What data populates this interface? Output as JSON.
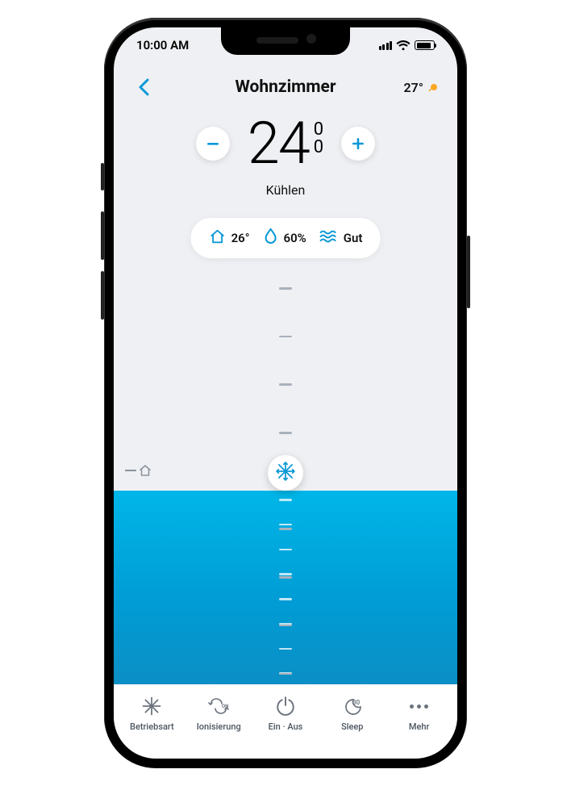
{
  "statusbar": {
    "time": "10:00 AM"
  },
  "header": {
    "room": "Wohnzimmer",
    "outside_temp": "27°"
  },
  "setpoint": {
    "whole": "24",
    "decimal_top": "0",
    "decimal_bottom": "0"
  },
  "mode_label": "Kühlen",
  "info": {
    "indoor_temp": "26°",
    "humidity": "60%",
    "air_quality": "Gut"
  },
  "nav": {
    "mode": "Betriebsart",
    "ion": "Ionisierung",
    "power": "Ein · Aus",
    "sleep": "Sleep",
    "sleep_minutes": "30",
    "more": "Mehr"
  }
}
